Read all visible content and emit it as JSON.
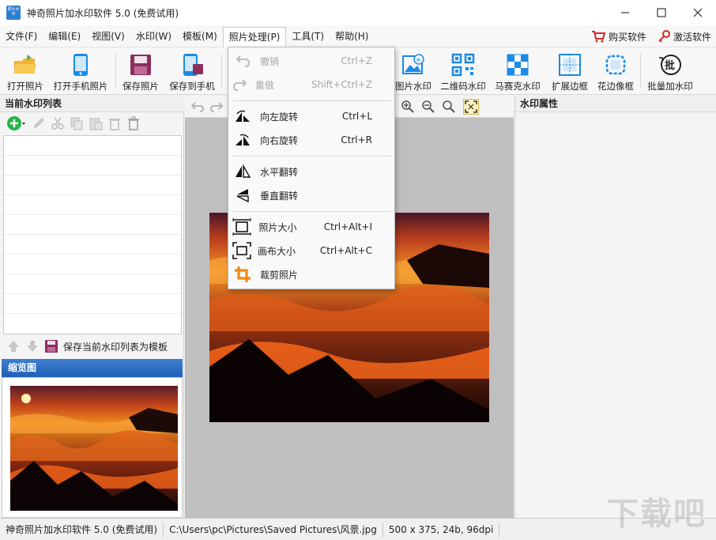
{
  "window": {
    "title": "神奇照片加水印软件 5.0 (免费试用)",
    "icon_text": "照片水印"
  },
  "menubar": {
    "items": [
      "文件(F)",
      "编辑(E)",
      "视图(V)",
      "水印(W)",
      "模板(M)",
      "照片处理(P)",
      "工具(T)",
      "帮助(H)"
    ],
    "active": "照片处理(P)",
    "buy": "购买软件",
    "activate": "激活软件"
  },
  "toolbar": {
    "open_photo": "打开照片",
    "open_phone_photo": "打开手机照片",
    "save_photo": "保存照片",
    "save_to_phone": "保存到手机",
    "photo_watermark": "图片水印",
    "qr_watermark": "二维码水印",
    "mosaic_watermark": "马赛克水印",
    "expand_border": "扩展边框",
    "flower_border": "花边像框",
    "batch_watermark": "批量加水印"
  },
  "left_panel": {
    "title": "当前水印列表",
    "save_template": "保存当前水印列表为模板",
    "thumbnail_title": "缩览图"
  },
  "right_panel": {
    "title": "水印属性"
  },
  "dropdown": {
    "items": [
      {
        "label": "撤销",
        "shortcut": "Ctrl+Z",
        "enabled": false,
        "icon": "undo-icon"
      },
      {
        "label": "重做",
        "shortcut": "Shift+Ctrl+Z",
        "enabled": false,
        "icon": "redo-icon"
      },
      {
        "label": "向左旋转",
        "shortcut": "Ctrl+L",
        "enabled": true,
        "icon": "rotate-left-icon"
      },
      {
        "label": "向右旋转",
        "shortcut": "Ctrl+R",
        "enabled": true,
        "icon": "rotate-right-icon"
      },
      {
        "label": "水平翻转",
        "shortcut": "",
        "enabled": true,
        "icon": "flip-horizontal-icon"
      },
      {
        "label": "垂直翻转",
        "shortcut": "",
        "enabled": true,
        "icon": "flip-vertical-icon"
      },
      {
        "label": "照片大小",
        "shortcut": "Ctrl+Alt+I",
        "enabled": true,
        "icon": "image-size-icon"
      },
      {
        "label": "画布大小",
        "shortcut": "Ctrl+Alt+C",
        "enabled": true,
        "icon": "canvas-size-icon"
      },
      {
        "label": "裁剪照片",
        "shortcut": "",
        "enabled": true,
        "icon": "crop-icon"
      }
    ]
  },
  "statusbar": {
    "app": "神奇照片加水印软件 5.0 (免费试用)",
    "path": "C:\\Users\\pc\\Pictures\\Saved Pictures\\风景.jpg",
    "info": "500 x 375, 24b, 96dpi"
  },
  "watermark_text": "下载吧",
  "colors": {
    "accent_blue": "#2a7fd4",
    "thumb_header": "#1e5fb5",
    "canvas_bg": "#c0bfc0",
    "icon_blue": "#1a8be6",
    "icon_red": "#d32a2a"
  }
}
